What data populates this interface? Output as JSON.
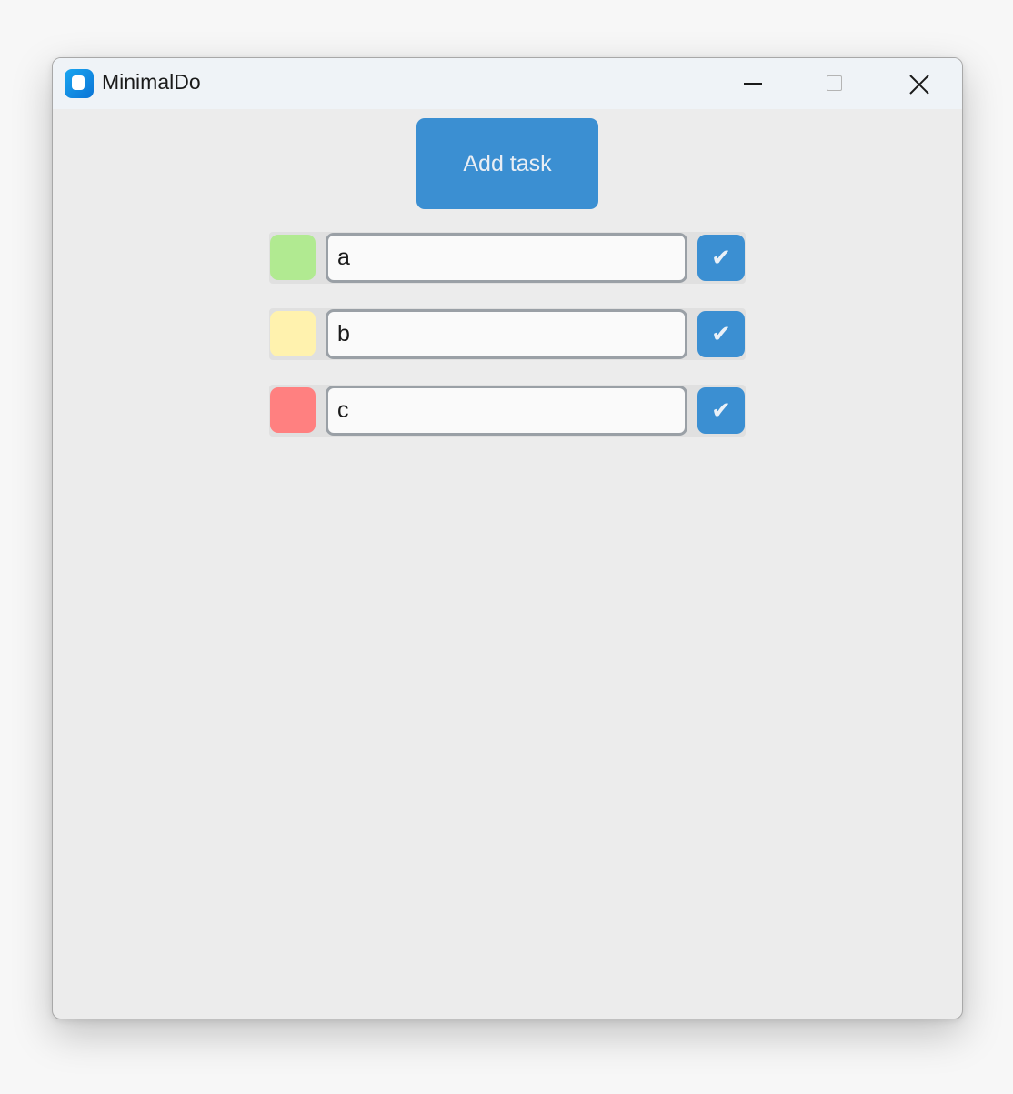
{
  "window": {
    "title": "MinimalDo",
    "controls": {
      "minimize": "minimize-icon",
      "maximize": "maximize-icon",
      "close": "close-icon"
    }
  },
  "toolbar": {
    "add_label": "Add task",
    "accent": "#3b8fd2"
  },
  "tasks": [
    {
      "value": "a",
      "color": "#b1ea91",
      "check_glyph": "✔"
    },
    {
      "value": "b",
      "color": "#fff2ae",
      "check_glyph": "✔"
    },
    {
      "value": "c",
      "color": "#ff8080",
      "check_glyph": "✔"
    }
  ]
}
